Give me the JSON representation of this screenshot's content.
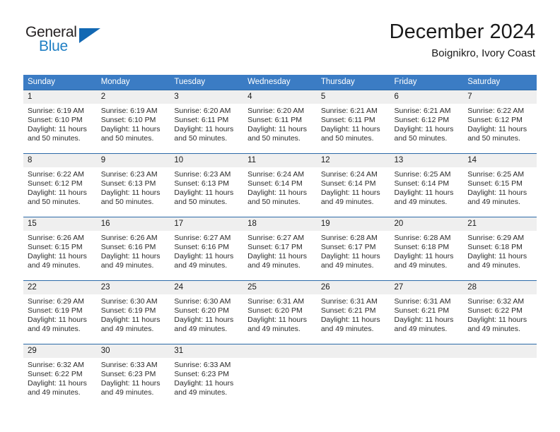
{
  "brand": {
    "name_part1": "General",
    "name_part2": "Blue",
    "colors": {
      "dark": "#231f20",
      "blue": "#1f7fc4",
      "triangle": "#1268b3"
    }
  },
  "header": {
    "month_title": "December 2024",
    "location": "Boignikro, Ivory Coast"
  },
  "theme": {
    "header_blue": "#3b7cc4",
    "row_border_blue": "#2c6aa8",
    "daynum_band": "#efefef"
  },
  "calendar": {
    "weekday_headers": [
      "Sunday",
      "Monday",
      "Tuesday",
      "Wednesday",
      "Thursday",
      "Friday",
      "Saturday"
    ],
    "weeks": [
      [
        {
          "day": "1",
          "sunrise": "Sunrise: 6:19 AM",
          "sunset": "Sunset: 6:10 PM",
          "daylight_line1": "Daylight: 11 hours",
          "daylight_line2": "and 50 minutes."
        },
        {
          "day": "2",
          "sunrise": "Sunrise: 6:19 AM",
          "sunset": "Sunset: 6:10 PM",
          "daylight_line1": "Daylight: 11 hours",
          "daylight_line2": "and 50 minutes."
        },
        {
          "day": "3",
          "sunrise": "Sunrise: 6:20 AM",
          "sunset": "Sunset: 6:11 PM",
          "daylight_line1": "Daylight: 11 hours",
          "daylight_line2": "and 50 minutes."
        },
        {
          "day": "4",
          "sunrise": "Sunrise: 6:20 AM",
          "sunset": "Sunset: 6:11 PM",
          "daylight_line1": "Daylight: 11 hours",
          "daylight_line2": "and 50 minutes."
        },
        {
          "day": "5",
          "sunrise": "Sunrise: 6:21 AM",
          "sunset": "Sunset: 6:11 PM",
          "daylight_line1": "Daylight: 11 hours",
          "daylight_line2": "and 50 minutes."
        },
        {
          "day": "6",
          "sunrise": "Sunrise: 6:21 AM",
          "sunset": "Sunset: 6:12 PM",
          "daylight_line1": "Daylight: 11 hours",
          "daylight_line2": "and 50 minutes."
        },
        {
          "day": "7",
          "sunrise": "Sunrise: 6:22 AM",
          "sunset": "Sunset: 6:12 PM",
          "daylight_line1": "Daylight: 11 hours",
          "daylight_line2": "and 50 minutes."
        }
      ],
      [
        {
          "day": "8",
          "sunrise": "Sunrise: 6:22 AM",
          "sunset": "Sunset: 6:12 PM",
          "daylight_line1": "Daylight: 11 hours",
          "daylight_line2": "and 50 minutes."
        },
        {
          "day": "9",
          "sunrise": "Sunrise: 6:23 AM",
          "sunset": "Sunset: 6:13 PM",
          "daylight_line1": "Daylight: 11 hours",
          "daylight_line2": "and 50 minutes."
        },
        {
          "day": "10",
          "sunrise": "Sunrise: 6:23 AM",
          "sunset": "Sunset: 6:13 PM",
          "daylight_line1": "Daylight: 11 hours",
          "daylight_line2": "and 50 minutes."
        },
        {
          "day": "11",
          "sunrise": "Sunrise: 6:24 AM",
          "sunset": "Sunset: 6:14 PM",
          "daylight_line1": "Daylight: 11 hours",
          "daylight_line2": "and 50 minutes."
        },
        {
          "day": "12",
          "sunrise": "Sunrise: 6:24 AM",
          "sunset": "Sunset: 6:14 PM",
          "daylight_line1": "Daylight: 11 hours",
          "daylight_line2": "and 49 minutes."
        },
        {
          "day": "13",
          "sunrise": "Sunrise: 6:25 AM",
          "sunset": "Sunset: 6:14 PM",
          "daylight_line1": "Daylight: 11 hours",
          "daylight_line2": "and 49 minutes."
        },
        {
          "day": "14",
          "sunrise": "Sunrise: 6:25 AM",
          "sunset": "Sunset: 6:15 PM",
          "daylight_line1": "Daylight: 11 hours",
          "daylight_line2": "and 49 minutes."
        }
      ],
      [
        {
          "day": "15",
          "sunrise": "Sunrise: 6:26 AM",
          "sunset": "Sunset: 6:15 PM",
          "daylight_line1": "Daylight: 11 hours",
          "daylight_line2": "and 49 minutes."
        },
        {
          "day": "16",
          "sunrise": "Sunrise: 6:26 AM",
          "sunset": "Sunset: 6:16 PM",
          "daylight_line1": "Daylight: 11 hours",
          "daylight_line2": "and 49 minutes."
        },
        {
          "day": "17",
          "sunrise": "Sunrise: 6:27 AM",
          "sunset": "Sunset: 6:16 PM",
          "daylight_line1": "Daylight: 11 hours",
          "daylight_line2": "and 49 minutes."
        },
        {
          "day": "18",
          "sunrise": "Sunrise: 6:27 AM",
          "sunset": "Sunset: 6:17 PM",
          "daylight_line1": "Daylight: 11 hours",
          "daylight_line2": "and 49 minutes."
        },
        {
          "day": "19",
          "sunrise": "Sunrise: 6:28 AM",
          "sunset": "Sunset: 6:17 PM",
          "daylight_line1": "Daylight: 11 hours",
          "daylight_line2": "and 49 minutes."
        },
        {
          "day": "20",
          "sunrise": "Sunrise: 6:28 AM",
          "sunset": "Sunset: 6:18 PM",
          "daylight_line1": "Daylight: 11 hours",
          "daylight_line2": "and 49 minutes."
        },
        {
          "day": "21",
          "sunrise": "Sunrise: 6:29 AM",
          "sunset": "Sunset: 6:18 PM",
          "daylight_line1": "Daylight: 11 hours",
          "daylight_line2": "and 49 minutes."
        }
      ],
      [
        {
          "day": "22",
          "sunrise": "Sunrise: 6:29 AM",
          "sunset": "Sunset: 6:19 PM",
          "daylight_line1": "Daylight: 11 hours",
          "daylight_line2": "and 49 minutes."
        },
        {
          "day": "23",
          "sunrise": "Sunrise: 6:30 AM",
          "sunset": "Sunset: 6:19 PM",
          "daylight_line1": "Daylight: 11 hours",
          "daylight_line2": "and 49 minutes."
        },
        {
          "day": "24",
          "sunrise": "Sunrise: 6:30 AM",
          "sunset": "Sunset: 6:20 PM",
          "daylight_line1": "Daylight: 11 hours",
          "daylight_line2": "and 49 minutes."
        },
        {
          "day": "25",
          "sunrise": "Sunrise: 6:31 AM",
          "sunset": "Sunset: 6:20 PM",
          "daylight_line1": "Daylight: 11 hours",
          "daylight_line2": "and 49 minutes."
        },
        {
          "day": "26",
          "sunrise": "Sunrise: 6:31 AM",
          "sunset": "Sunset: 6:21 PM",
          "daylight_line1": "Daylight: 11 hours",
          "daylight_line2": "and 49 minutes."
        },
        {
          "day": "27",
          "sunrise": "Sunrise: 6:31 AM",
          "sunset": "Sunset: 6:21 PM",
          "daylight_line1": "Daylight: 11 hours",
          "daylight_line2": "and 49 minutes."
        },
        {
          "day": "28",
          "sunrise": "Sunrise: 6:32 AM",
          "sunset": "Sunset: 6:22 PM",
          "daylight_line1": "Daylight: 11 hours",
          "daylight_line2": "and 49 minutes."
        }
      ],
      [
        {
          "day": "29",
          "sunrise": "Sunrise: 6:32 AM",
          "sunset": "Sunset: 6:22 PM",
          "daylight_line1": "Daylight: 11 hours",
          "daylight_line2": "and 49 minutes."
        },
        {
          "day": "30",
          "sunrise": "Sunrise: 6:33 AM",
          "sunset": "Sunset: 6:23 PM",
          "daylight_line1": "Daylight: 11 hours",
          "daylight_line2": "and 49 minutes."
        },
        {
          "day": "31",
          "sunrise": "Sunrise: 6:33 AM",
          "sunset": "Sunset: 6:23 PM",
          "daylight_line1": "Daylight: 11 hours",
          "daylight_line2": "and 49 minutes."
        },
        {
          "day": "",
          "sunrise": "",
          "sunset": "",
          "daylight_line1": "",
          "daylight_line2": ""
        },
        {
          "day": "",
          "sunrise": "",
          "sunset": "",
          "daylight_line1": "",
          "daylight_line2": ""
        },
        {
          "day": "",
          "sunrise": "",
          "sunset": "",
          "daylight_line1": "",
          "daylight_line2": ""
        },
        {
          "day": "",
          "sunrise": "",
          "sunset": "",
          "daylight_line1": "",
          "daylight_line2": ""
        }
      ]
    ]
  }
}
